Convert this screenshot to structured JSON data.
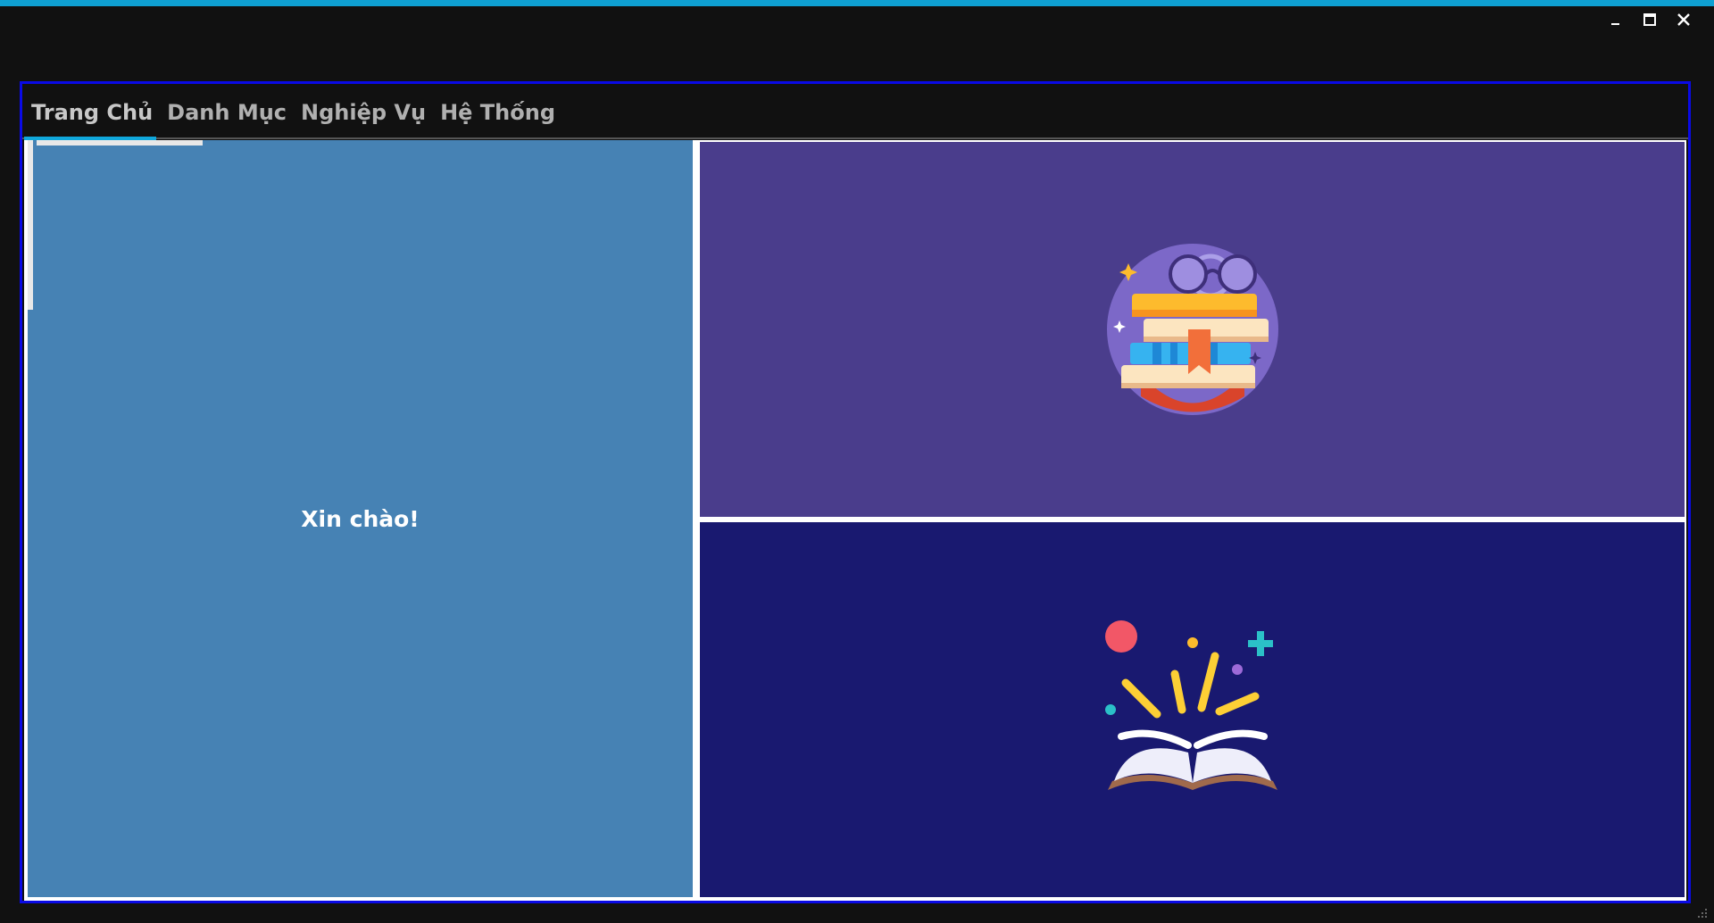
{
  "window": {
    "accent_color": "#0fa0d2",
    "controls": [
      "minimize-icon",
      "maximize-icon",
      "close-icon"
    ]
  },
  "tabs": [
    {
      "label": "Trang Chủ",
      "active": true
    },
    {
      "label": "Danh Mục",
      "active": false
    },
    {
      "label": "Nghiệp Vụ",
      "active": false
    },
    {
      "label": "Hệ Thống",
      "active": false
    }
  ],
  "home": {
    "greeting": "Xin chào!",
    "left_color": "#4682b4",
    "top_right_color": "#4a3d8c",
    "bottom_right_color": "#191970",
    "top_illustration": "books-stack-icon",
    "bottom_illustration": "open-book-icon"
  },
  "frame_border_color": "#0a0ae6"
}
